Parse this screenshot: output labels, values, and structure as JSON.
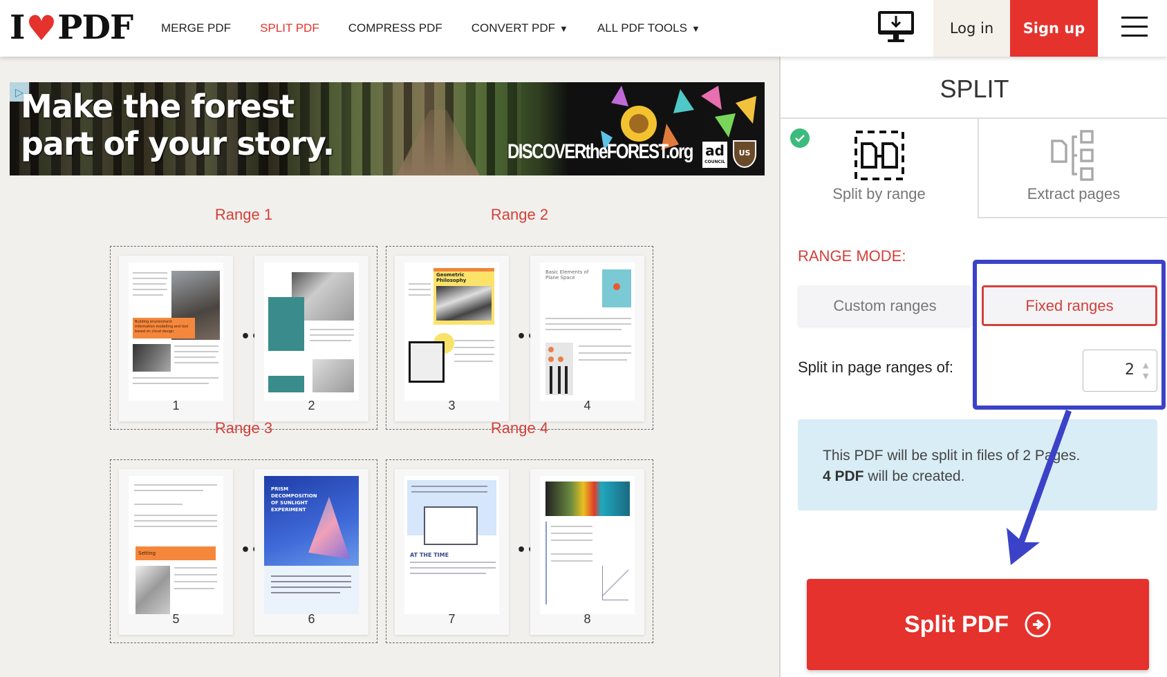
{
  "header": {
    "logo_left": "I",
    "logo_right": "PDF",
    "nav": [
      {
        "label": "MERGE PDF",
        "active": false
      },
      {
        "label": "SPLIT PDF",
        "active": true
      },
      {
        "label": "COMPRESS PDF",
        "active": false
      },
      {
        "label": "CONVERT PDF",
        "active": false,
        "dropdown": true
      },
      {
        "label": "ALL PDF TOOLS",
        "active": false,
        "dropdown": true
      }
    ],
    "caret": "▼",
    "desktop_icon": "desktop-download-icon",
    "login_label": "Log in",
    "signup_label": "Sign up",
    "menu_icon": "hamburger-menu-icon"
  },
  "ad": {
    "headline_line1": "Make the forest",
    "headline_line2": "part of your story.",
    "url": "DISCOVERtheFOREST.org",
    "council_label": "ad",
    "council_sub": "COUNCIL",
    "usfs_label": "US",
    "badge_icon": "ad-choices-icon"
  },
  "ranges": [
    {
      "title": "Range 1",
      "pages": [
        "1",
        "2"
      ]
    },
    {
      "title": "Range 2",
      "pages": [
        "3",
        "4"
      ]
    },
    {
      "title": "Range 3",
      "pages": [
        "5",
        "6"
      ]
    },
    {
      "title": "Range 4",
      "pages": [
        "7",
        "8"
      ]
    }
  ],
  "ellipsis": "•••",
  "page_content": {
    "p1_heading": "Building environment information modelling and tool based on cloud design",
    "p3_heading": "Geometric Philosophy",
    "p4_heading": "Basic Elements of Plane Space",
    "p5_heading": "Setting",
    "p6_heading": "PRISM DECOMPOSITION OF SUNLIGHT EXPERIMENT",
    "p7_heading": "AT THE TIME"
  },
  "sidebar": {
    "title": "SPLIT",
    "tabs": [
      {
        "label": "Split by range",
        "selected": true
      },
      {
        "label": "Extract pages",
        "selected": false
      }
    ],
    "range_mode_label": "RANGE MODE:",
    "mode_options": [
      {
        "label": "Custom ranges",
        "selected": false
      },
      {
        "label": "Fixed ranges",
        "selected": true
      }
    ],
    "split_label": "Split in page ranges of:",
    "split_value": "2",
    "info_line1": "This PDF will be split in files of 2 Pages.",
    "info_bold": "4 PDF",
    "info_line2_rest": " will be created.",
    "split_button_label": "Split PDF"
  },
  "colors": {
    "brand_red": "#e5322d",
    "range_red": "#d3403a",
    "annotation_blue": "#3b42c8",
    "check_green": "#3dbb7c",
    "info_bg": "#d9edf6"
  }
}
